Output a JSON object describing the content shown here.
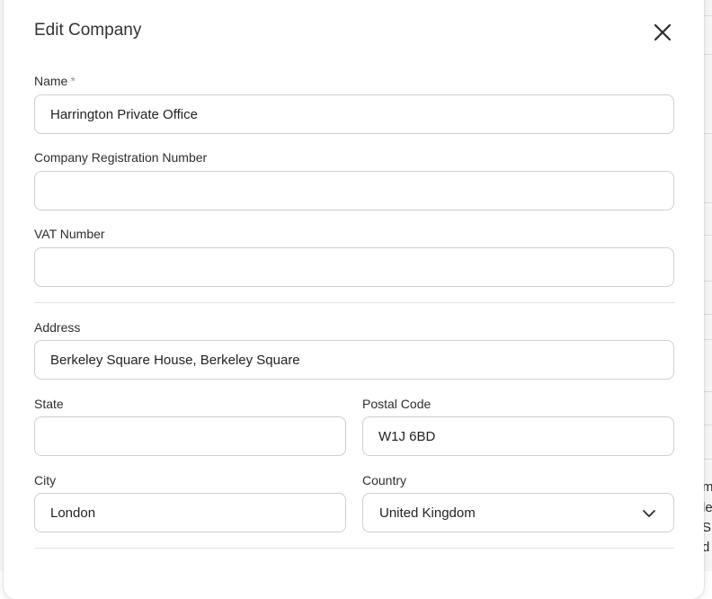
{
  "backdrop": {
    "fragments": [
      "m",
      "le",
      "SE",
      "d"
    ]
  },
  "modal": {
    "title": "Edit Company",
    "close_icon": "close-icon"
  },
  "form": {
    "name": {
      "label": "Name",
      "required_mark": "*",
      "value": "Harrington Private Office"
    },
    "company_registration_number": {
      "label": "Company Registration Number",
      "value": ""
    },
    "vat_number": {
      "label": "VAT Number",
      "value": ""
    },
    "address": {
      "label": "Address",
      "value": "Berkeley Square House, Berkeley Square"
    },
    "state": {
      "label": "State",
      "value": ""
    },
    "postal_code": {
      "label": "Postal Code",
      "value": "W1J 6BD"
    },
    "city": {
      "label": "City",
      "value": "London"
    },
    "country": {
      "label": "Country",
      "value": "United Kingdom",
      "icon": "chevron-down-icon"
    }
  }
}
